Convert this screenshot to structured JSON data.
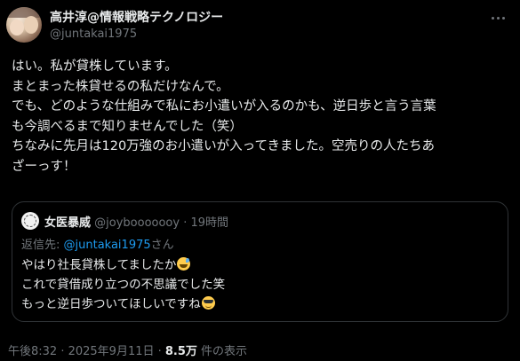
{
  "author": {
    "name": "高井淳@情報戦略テクノロジー",
    "handle": "@juntakai1975"
  },
  "tweet": {
    "lines": [
      "はい。私が貸株しています。",
      "まとまった株貸せるの私だけなんで。",
      "でも、どのような仕組みで私にお小遣いが入るのかも、逆日歩と言う言葉",
      "も今調べるまで知りませんでした（笑）",
      "ちなみに先月は120万強のお小遣いが入ってきました。空売りの人たちあ",
      "ざーっす！"
    ]
  },
  "quote": {
    "name": "女医暴威",
    "handle": "@joybooooooy",
    "dot": "·",
    "time": "19時間",
    "reply_prefix": "返信先: ",
    "reply_mention": "@juntakai1975",
    "reply_suffix": "さん",
    "lines": [
      "やはり社長貸株してましたか",
      "これで貸借成り立つの不思議でした笑",
      "もっと逆日歩ついてほしいですね"
    ],
    "emoji": [
      "grinning-sweat-emoji",
      "sunglasses-emoji"
    ]
  },
  "meta": {
    "timestamp": "午後8:32 · 2025年9月11日 · ",
    "views": "8.5万",
    "views_suffix": " 件の表示"
  },
  "colors": {
    "background": "#000000",
    "text": "#e7e9ea",
    "muted": "#71767b",
    "link": "#1d9bf0",
    "border": "#2f3336"
  }
}
